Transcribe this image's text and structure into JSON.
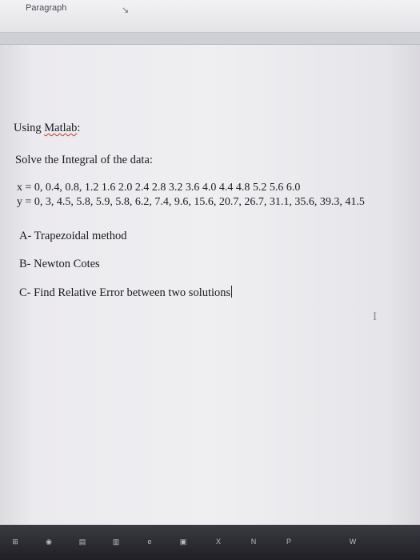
{
  "ribbon": {
    "group_label": "Paragraph",
    "launcher_icon": "dialog-launcher-icon"
  },
  "document": {
    "line1_prefix": "Using ",
    "line1_word": "Matlab",
    "line1_suffix": ":",
    "prompt": "Solve the Integral of the data:",
    "x_line": "x = 0, 0.4, 0.8, 1.2 1.6 2.0 2.4 2.8 3.2 3.6 4.0 4.4 4.8 5.2 5.6 6.0",
    "y_line": "y = 0, 3, 4.5, 5.8, 5.9, 5.8, 6.2, 7.4, 9.6, 15.6, 20.7, 26.7, 31.1, 35.6, 39.3, 41.5",
    "item_a": "A- Trapezoidal method",
    "item_b": "B- Newton Cotes",
    "item_c": "C- Find Relative Error between two solutions"
  },
  "colors": {
    "taskbar": "#26262c",
    "text": "#1b1b1f",
    "spellcheck": "#c0392b"
  },
  "taskbar": {
    "icons": [
      {
        "name": "start-icon",
        "glyph": "⊞"
      },
      {
        "name": "chrome-icon",
        "glyph": "◉"
      },
      {
        "name": "explorer-icon",
        "glyph": "▤"
      },
      {
        "name": "store-icon",
        "glyph": "▥"
      },
      {
        "name": "edge-icon",
        "glyph": "e"
      },
      {
        "name": "app-icon",
        "glyph": "▣"
      },
      {
        "name": "excel-icon",
        "glyph": "X"
      },
      {
        "name": "onenote-icon",
        "glyph": "N"
      },
      {
        "name": "powerpoint-icon",
        "glyph": "P"
      },
      {
        "name": "word-icon",
        "glyph": "W"
      }
    ]
  }
}
